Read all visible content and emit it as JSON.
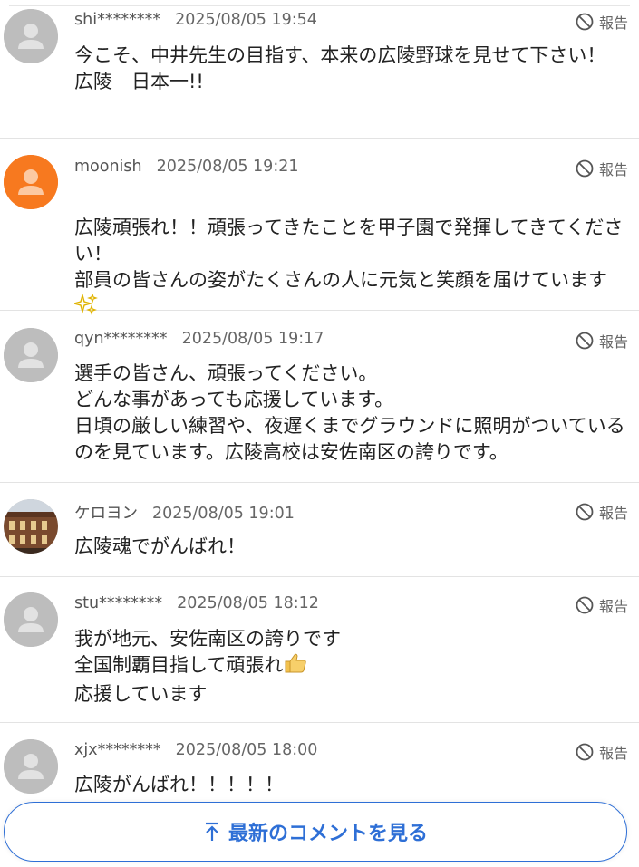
{
  "comments": [
    {
      "user": "shi********",
      "time": "2025/08/05 19:54",
      "report": "報告",
      "avatar": "default-gray",
      "text": "今こそ、中井先生の目指す、本来の広陵野球を見せて下さい！\n広陵　日本一!!"
    },
    {
      "user": "moonish",
      "time": "2025/08/05 19:21",
      "report": "報告",
      "avatar": "default-orange",
      "text_main": "広陵頑張れ！！頑張ってきたことを甲子園で発揮してきてください！\n部員の皆さんの姿がたくさんの人に元気と笑顔を届けています",
      "emoji": "sparkles-icon"
    },
    {
      "user": "qyn********",
      "time": "2025/08/05 19:17",
      "report": "報告",
      "avatar": "default-gray",
      "text": "選手の皆さん、頑張ってください。\nどんな事があっても応援しています。\n日頃の厳しい練習や、夜遅くまでグラウンドに照明がついているのを見ています。広陵高校は安佐南区の誇りです。"
    },
    {
      "user": "ケロヨン",
      "time": "2025/08/05 19:01",
      "report": "報告",
      "avatar": "photo-building",
      "text": "広陵魂でがんばれ！"
    },
    {
      "user": "stu********",
      "time": "2025/08/05 18:12",
      "report": "報告",
      "avatar": "default-gray",
      "text_line1": "我が地元、安佐南区の誇りです",
      "text_line2": "全国制覇目指して頑張れ",
      "text_line3": "応援しています",
      "emoji": "thumbs-up-icon"
    },
    {
      "user": "xjx********",
      "time": "2025/08/05 18:00",
      "report": "報告",
      "avatar": "default-gray",
      "text": "広陵がんばれ！！！！！"
    }
  ],
  "latest_button": {
    "label": "最新のコメントを見る",
    "icon": "arrow-up-icon",
    "color": "#2e6fd6"
  },
  "colors": {
    "avatar_gray": "#bdbdbd",
    "avatar_orange": "#f7791f"
  }
}
